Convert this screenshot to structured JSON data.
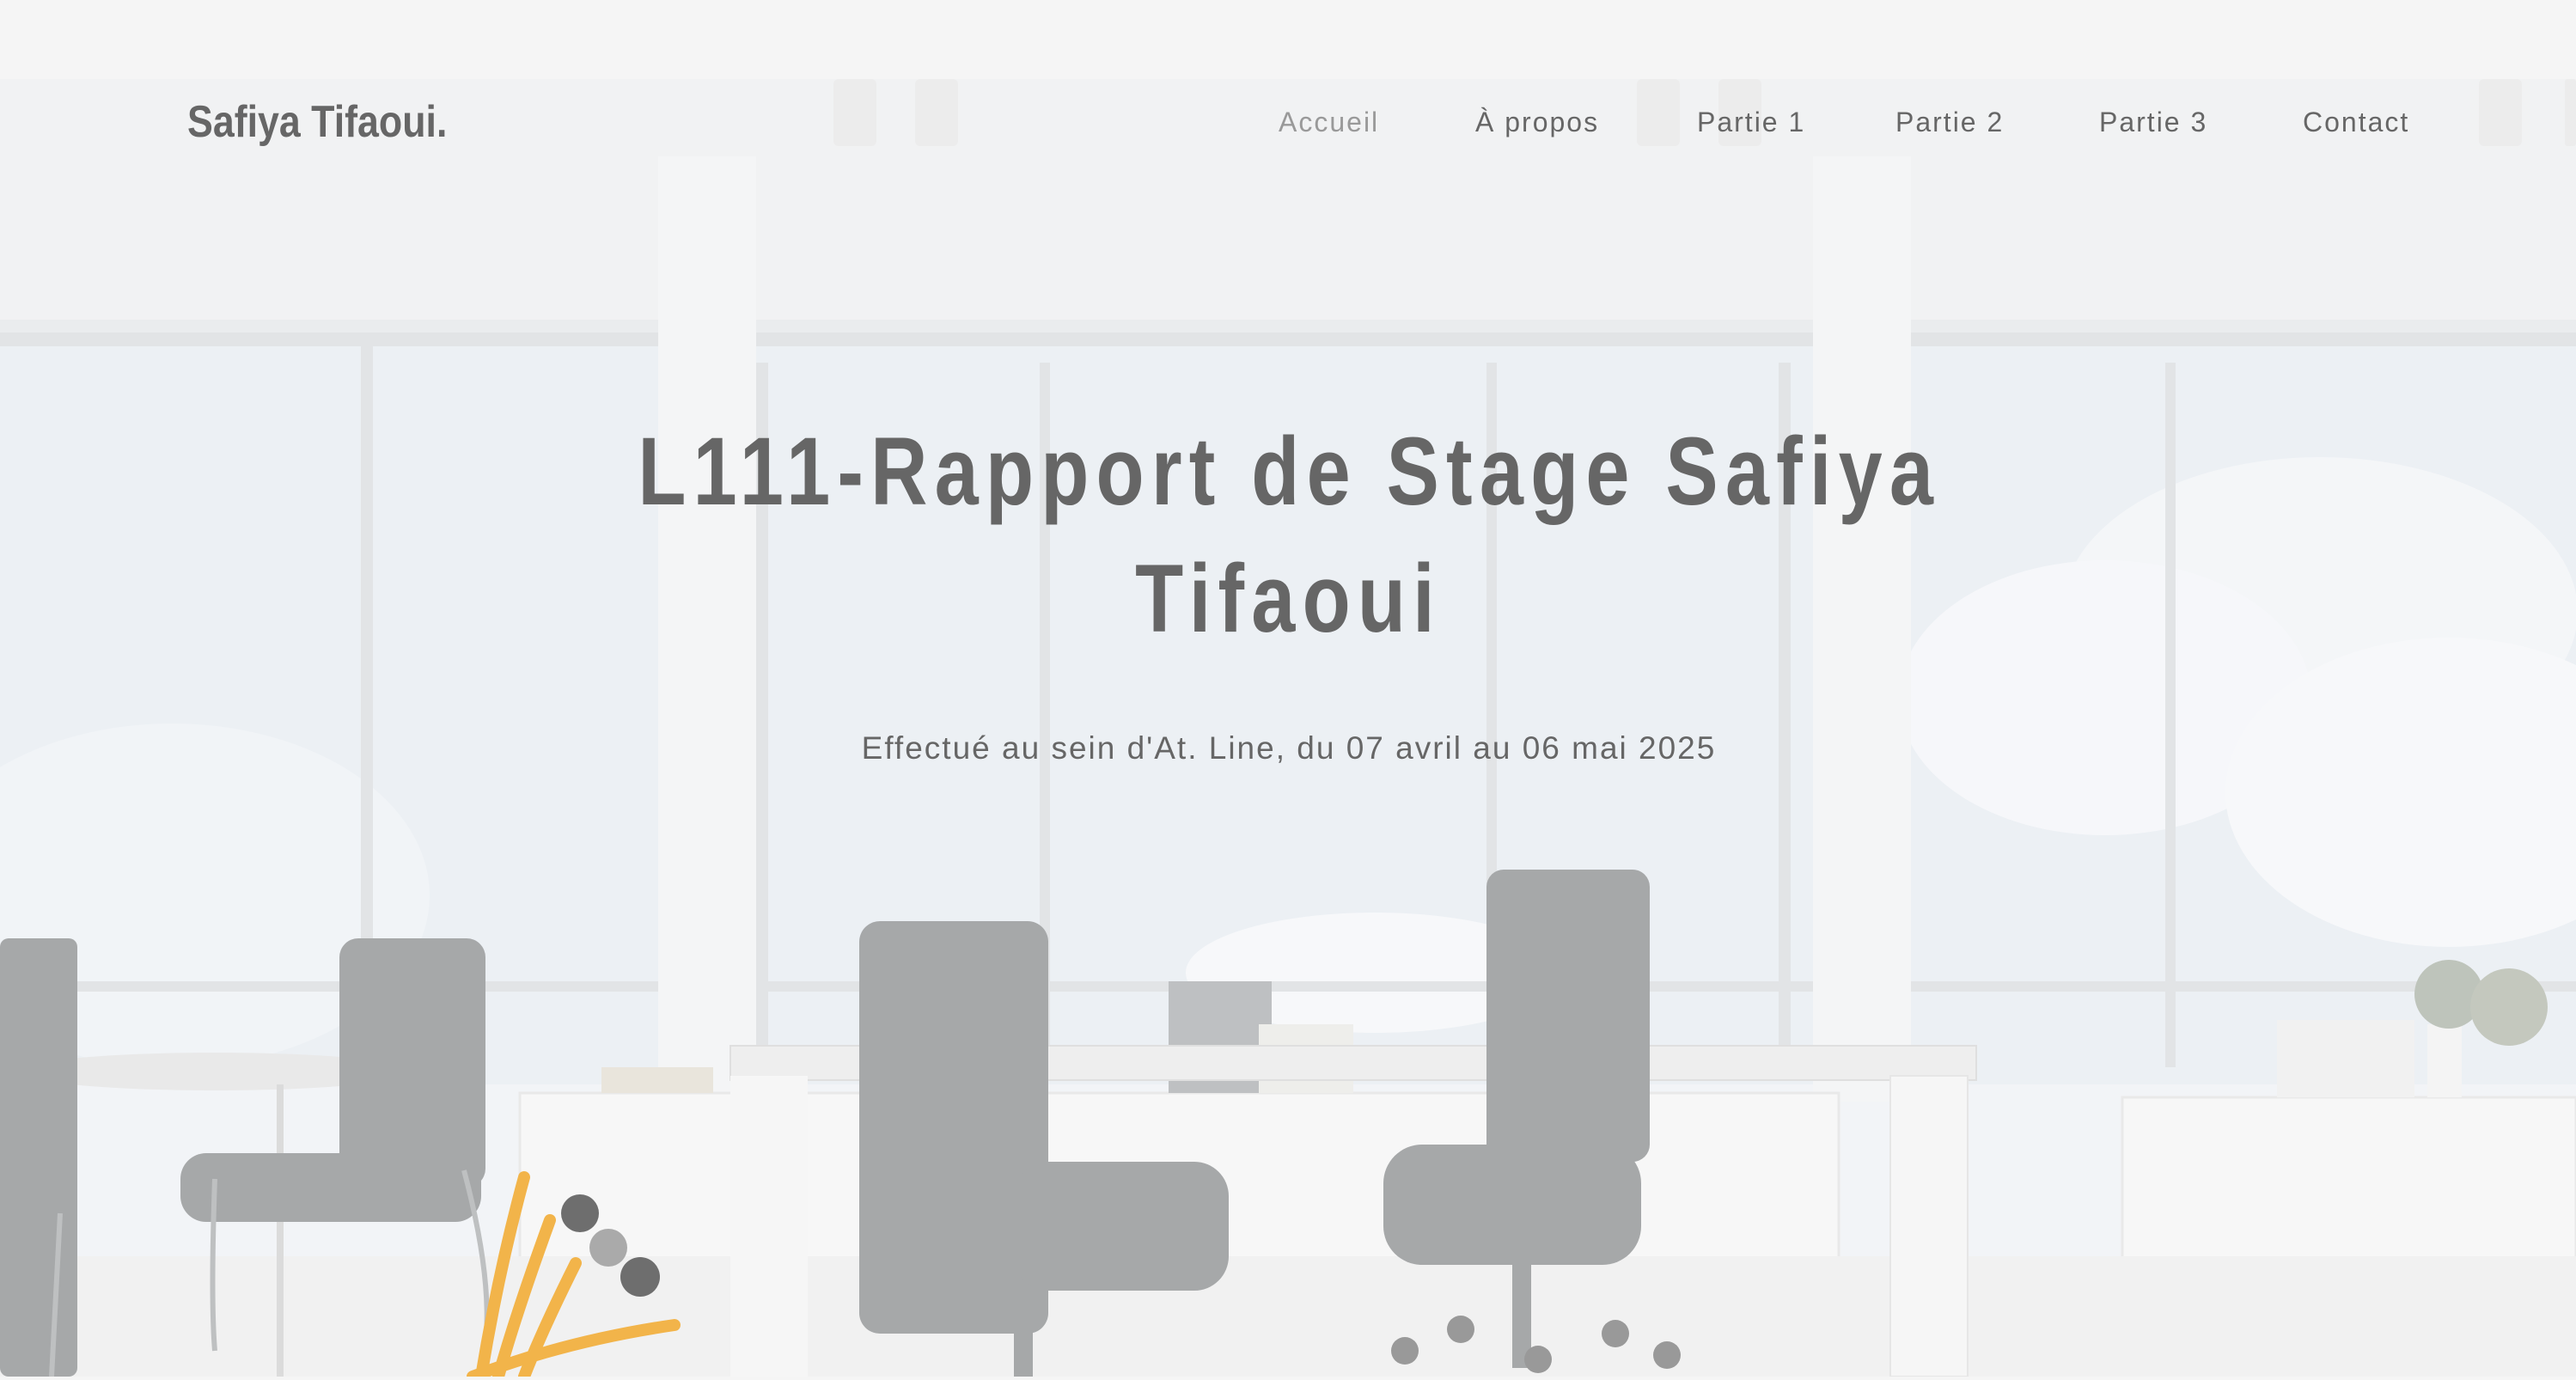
{
  "brand": {
    "name": "Safiya Tifaoui."
  },
  "nav": {
    "items": [
      {
        "label": "Accueil",
        "active": true
      },
      {
        "label": "À propos",
        "active": false
      },
      {
        "label": "Partie 1",
        "active": false
      },
      {
        "label": "Partie 2",
        "active": false
      },
      {
        "label": "Partie 3",
        "active": false
      },
      {
        "label": "Contact",
        "active": false
      }
    ]
  },
  "hero": {
    "title_line1": "L111-Rapport de Stage Safiya",
    "title_line2": "Tifaoui",
    "subtitle": "Effectué au sein d'At. Line, du 07 avril au 06 mai 2025"
  },
  "colors": {
    "text": "#666666",
    "nav_active": "#999999",
    "background": "#f5f5f5",
    "widget_accent": "#f2b44a"
  },
  "icons": [
    "spiral-logo-icon"
  ]
}
